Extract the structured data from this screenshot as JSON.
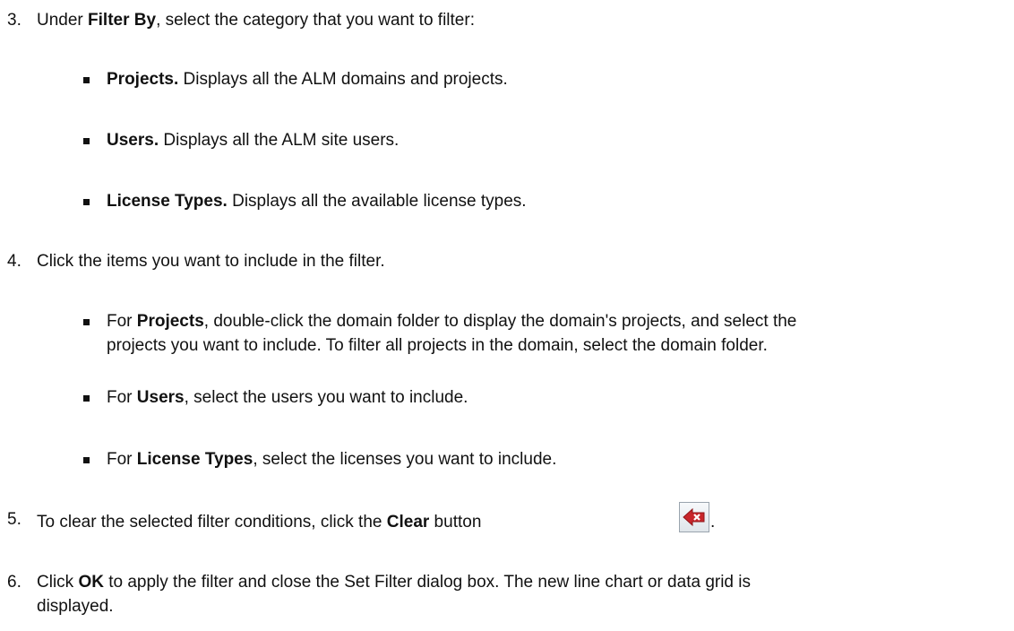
{
  "steps": [
    {
      "number": "3.",
      "pre": "Under ",
      "bold": "Filter By",
      "post": ", select the category that you want to filter:",
      "bullets": [
        {
          "bold": "Projects.",
          "text": " Displays all the ALM domains and projects."
        },
        {
          "bold": "Users.",
          "text": " Displays all the ALM site users."
        },
        {
          "bold": "License Types.",
          "text": " Displays all the available license types."
        }
      ]
    },
    {
      "number": "4.",
      "text": "Click the items you want to include in the filter.",
      "bullets": [
        {
          "pre": "For ",
          "bold": "Projects",
          "line1": ", double-click the domain folder to display the domain's projects, and select the",
          "line2": "projects you want to include. To filter all projects in the domain, select the domain folder."
        },
        {
          "pre": "For ",
          "bold": "Users",
          "text": ", select the users you want to include."
        },
        {
          "pre": "For ",
          "bold": "License Types",
          "text": ", select the licenses you want to include."
        }
      ]
    },
    {
      "number": "5.",
      "pre": "To clear the selected filter conditions, click the ",
      "bold": "Clear",
      "mid": " button ",
      "post": ".",
      "icon": "clear-filter-icon"
    },
    {
      "number": "6.",
      "pre": "Click ",
      "bold": "OK",
      "line1": " to apply the filter and close the Set Filter dialog box. The new line chart or data grid is",
      "line2": "displayed."
    }
  ],
  "colors": {
    "text": "#111111",
    "icon_red": "#c8262b"
  }
}
